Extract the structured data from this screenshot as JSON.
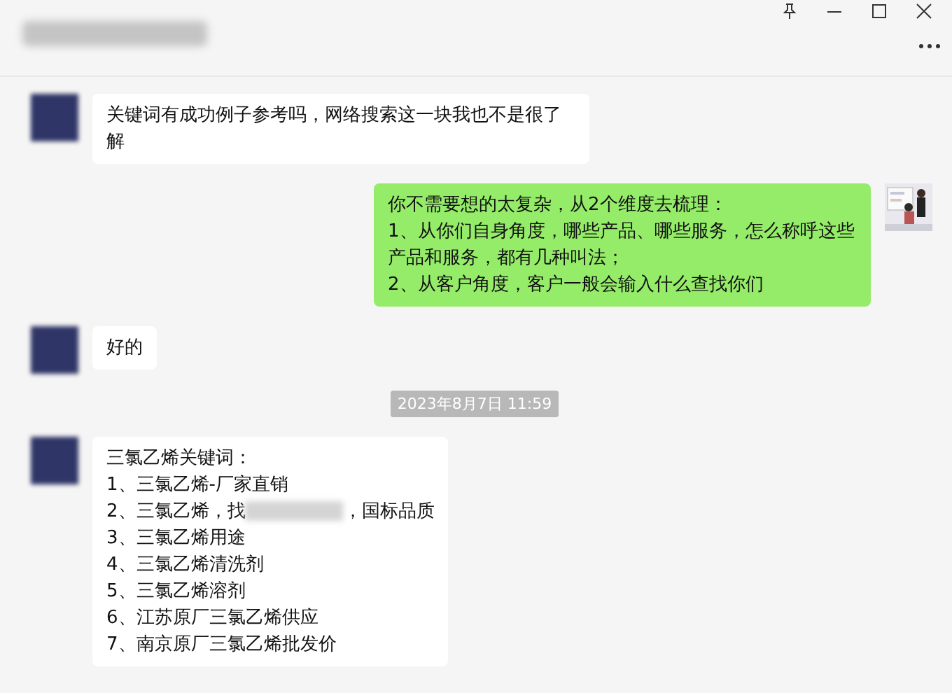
{
  "messages": [
    {
      "kind": "text",
      "outgoing": false,
      "photo_avatar": false,
      "lines": [
        [
          "关键词有成功例子参考吗，网络搜索这一块我也不是很了解"
        ]
      ]
    },
    {
      "kind": "text",
      "outgoing": true,
      "photo_avatar": true,
      "lines": [
        [
          "你不需要想的太复杂，从2个维度去梳理："
        ],
        [
          "1、从你们自身角度，哪些产品、哪些服务，怎么称呼这些产品和服务，都有几种叫法；"
        ],
        [
          "2、从客户角度，客户一般会输入什么查找你们"
        ]
      ]
    },
    {
      "kind": "text",
      "outgoing": false,
      "photo_avatar": false,
      "lines": [
        [
          "好的"
        ]
      ]
    },
    {
      "kind": "time",
      "text": "2023年8月7日 11:59"
    },
    {
      "kind": "text",
      "outgoing": false,
      "photo_avatar": false,
      "lines": [
        [
          "三氯乙烯关键词："
        ],
        [
          "1、三氯乙烯-厂家直销"
        ],
        [
          "2、三氯乙烯，找",
          "，国标品质"
        ],
        [
          "3、三氯乙烯用途"
        ],
        [
          "4、三氯乙烯清洗剂"
        ],
        [
          "5、三氯乙烯溶剂"
        ],
        [
          "6、江苏原厂三氯乙烯供应"
        ],
        [
          "7、南京原厂三氯乙烯批发价"
        ]
      ]
    }
  ]
}
